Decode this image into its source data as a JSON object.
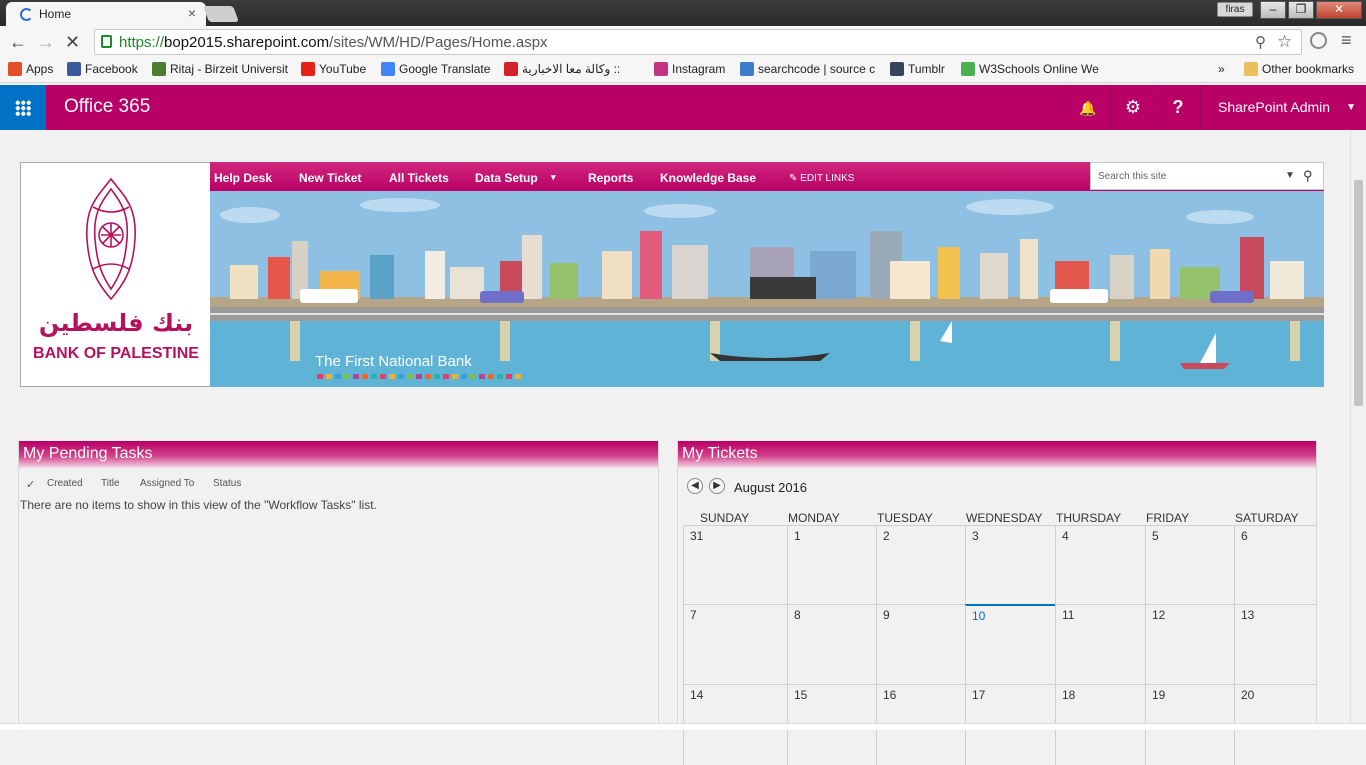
{
  "browser": {
    "tab_title": "Home",
    "tab_close": "×",
    "profile_name": "firas",
    "window_buttons": [
      "‒",
      "❐",
      "✕"
    ],
    "back": "←",
    "forward": "→",
    "stop": "✕",
    "url_protocol": "https://",
    "url_host": "bop2015.sharepoint.com",
    "url_path": "/sites/WM/HD/Pages/Home.aspx",
    "zoom_icon": "⚲",
    "star_icon": "☆",
    "menu_icon": "≡"
  },
  "bookmarks": {
    "items": [
      {
        "label": "Apps",
        "color": "#e34f26"
      },
      {
        "label": "Facebook",
        "color": "#3b5998"
      },
      {
        "label": "Ritaj - Birzeit Universit",
        "color": "#4a7d2f"
      },
      {
        "label": "YouTube",
        "color": "#e62117"
      },
      {
        "label": "Google Translate",
        "color": "#4285f4"
      },
      {
        "label": "وكالة معا الاخبارية ::",
        "color": "#d42027"
      },
      {
        "label": "Instagram",
        "color": "#c13584"
      },
      {
        "label": "searchcode | source c",
        "color": "#3d7cc9"
      },
      {
        "label": "Tumblr",
        "color": "#35465c"
      },
      {
        "label": "W3Schools Online We",
        "color": "#4caf50"
      }
    ],
    "overflow": "»",
    "other": "Other bookmarks"
  },
  "suitebar": {
    "brand": "Office 365",
    "bell_icon": "🔔",
    "gear_icon": "⚙",
    "help_icon": "?",
    "user": "SharePoint Admin",
    "colors": {
      "suite": "#b80066",
      "waffle": "#0072c6"
    }
  },
  "site": {
    "logo_arabic": "بنك فلسطين",
    "logo_english": "BANK OF PALESTINE",
    "nav": [
      "Help Desk",
      "New Ticket",
      "All Tickets",
      "Data Setup",
      "Reports",
      "Knowledge Base"
    ],
    "nav_dropdown": "▾",
    "edit_links": "EDIT LINKS",
    "search_placeholder": "Search this site",
    "banner_caption": "The First National Bank",
    "banner_dot_colors": [
      "#e33d6b",
      "#f2b02d",
      "#3aa0d8",
      "#7ec04a",
      "#b4468f",
      "#f06a2e",
      "#2bb3a8",
      "#e33d6b",
      "#f2b02d",
      "#3aa0d8",
      "#7ec04a",
      "#b4468f",
      "#f06a2e",
      "#2bb3a8",
      "#e33d6b",
      "#f2b02d",
      "#3aa0d8",
      "#7ec04a",
      "#b4468f",
      "#f06a2e",
      "#2bb3a8",
      "#e33d6b",
      "#f2b02d"
    ]
  },
  "tasks": {
    "title": "My Pending Tasks",
    "check": "✓",
    "columns": [
      "Created",
      "Title",
      "Assigned To",
      "Status"
    ],
    "empty_message": "There are no items to show in this view of the \"Workflow Tasks\" list."
  },
  "tickets": {
    "title": "My Tickets",
    "prev": "◀",
    "next": "▶",
    "month": "August 2016",
    "days": [
      "SUNDAY",
      "MONDAY",
      "TUESDAY",
      "WEDNESDAY",
      "THURSDAY",
      "FRIDAY",
      "SATURDAY"
    ],
    "weeks": [
      [
        "31",
        "1",
        "2",
        "3",
        "4",
        "5",
        "6"
      ],
      [
        "7",
        "8",
        "9",
        "10",
        "11",
        "12",
        "13"
      ],
      [
        "14",
        "15",
        "16",
        "17",
        "18",
        "19",
        "20"
      ]
    ],
    "today": "10"
  }
}
